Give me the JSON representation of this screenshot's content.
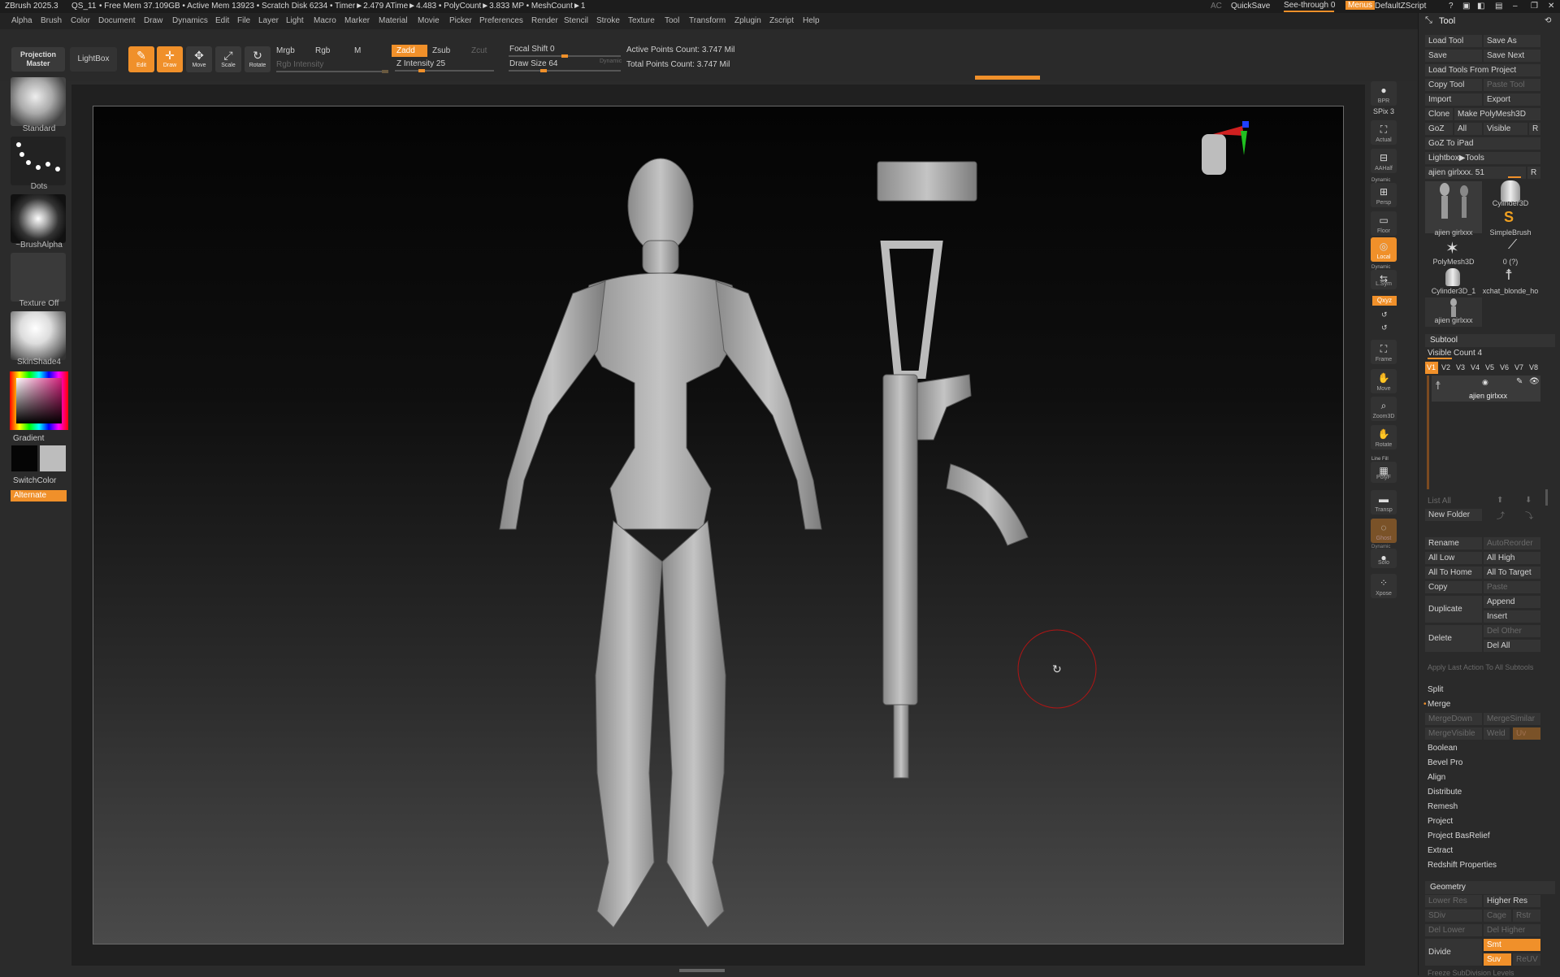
{
  "titlebar": {
    "app": "ZBrush 2025.3",
    "doc": "QS_11",
    "stats": "• Free Mem 37.109GB • Active Mem 13923 • Scratch Disk 6234 • Timer►2.479 ATime►4.483 • PolyCount►3.833 MP • MeshCount►1",
    "ac": "AC",
    "quicksave": "QuickSave",
    "seethrough": "See-through 0",
    "menus": "Menus",
    "script": "DefaultZScript"
  },
  "menu": [
    "Alpha",
    "Brush",
    "Color",
    "Document",
    "Draw",
    "Dynamics",
    "Edit",
    "File",
    "Layer",
    "Light",
    "Macro",
    "Marker",
    "Material",
    "Movie",
    "Picker",
    "Preferences",
    "Render",
    "Stencil",
    "Stroke",
    "Texture",
    "Tool",
    "Transform",
    "Zplugin",
    "Zscript",
    "Help"
  ],
  "toolbar": {
    "projection_master": "Projection Master",
    "lightbox": "LightBox",
    "edit": "Edit",
    "draw": "Draw",
    "move": "Move",
    "scale": "Scale",
    "rotate": "Rotate",
    "mrgb": "Mrgb",
    "rgb": "Rgb",
    "m": "M",
    "rgb_intensity": "Rgb Intensity",
    "zadd": "Zadd",
    "zsub": "Zsub",
    "zcut": "Zcut",
    "z_intensity": "Z Intensity 25",
    "focal_shift": "Focal Shift 0",
    "draw_size": "Draw Size 64",
    "dynamic": "Dynamic",
    "active_points": "Active Points Count: 3.747 Mil",
    "total_points": "Total Points Count: 3.747 Mil",
    "z_intensity_level": 0.25,
    "draw_size_level": 0.3
  },
  "leftshelf": {
    "standard": "Standard",
    "dots": "Dots",
    "brushalpha": "~BrushAlpha",
    "texture_off": "Texture Off",
    "skinshade": "SkinShade4",
    "gradient": "Gradient",
    "switchcolor": "SwitchColor",
    "alternate": "Alternate"
  },
  "rightshelf": {
    "bpr": "BPR",
    "spix": "SPix 3",
    "actual": "Actual",
    "aahalf": "AAHalf",
    "dynamic1": "Dynamic",
    "persp": "Persp",
    "floor": "Floor",
    "local": "Local",
    "dynamic2": "Dynamic",
    "lsym": "L.Sym",
    "xyz": "Qxyz",
    "frame": "Frame",
    "move": "Move",
    "zoom3d": "Zoom3D",
    "rotate": "Rotate",
    "linefill": "Line Fill",
    "polyf": "PolyF",
    "transp": "Transp",
    "ghost": "Ghost",
    "dynamic3": "Dynamic",
    "solo": "Solo",
    "xpose": "Xpose"
  },
  "toolpanel": {
    "title": "Tool",
    "load_tool": "Load Tool",
    "save_as": "Save As",
    "save": "Save",
    "save_next": "Save Next",
    "load_from_project": "Load Tools From Project",
    "copy_tool": "Copy Tool",
    "paste_tool": "Paste Tool",
    "import": "Import",
    "export": "Export",
    "clone": "Clone",
    "make_polymesh": "Make PolyMesh3D",
    "goz": "GoZ",
    "all": "All",
    "visible": "Visible",
    "r": "R",
    "goz_ipad": "GoZ To iPad",
    "lightbox_tools": "Lightbox▶Tools",
    "current_tool": "ajien girlxxx. 51",
    "tools": [
      "ajien girlxxx",
      "Cylinder3D",
      "SimpleBrush",
      "PolyMesh3D",
      "0 (?)",
      "Cylinder3D_1",
      "xchat_blonde_ho",
      "ajien girlxxx"
    ],
    "subtool": "Subtool",
    "visible_count": "Visible Count 4",
    "v_tabs": [
      "V1",
      "V2",
      "V3",
      "V4",
      "V5",
      "V6",
      "V7",
      "V8"
    ],
    "subtool_name": "ajien girlxxx",
    "list_all": "List All",
    "new_folder": "New Folder",
    "rename": "Rename",
    "auto_reorder": "AutoReorder",
    "all_low": "All Low",
    "all_high": "All High",
    "all_to_home": "All To Home",
    "all_to_target": "All To Target",
    "copy": "Copy",
    "paste": "Paste",
    "duplicate": "Duplicate",
    "append": "Append",
    "insert": "Insert",
    "delete": "Delete",
    "del_other": "Del Other",
    "del_all": "Del All",
    "apply_last": "Apply Last Action To All Subtools",
    "split": "Split",
    "merge": "Merge",
    "merge_down": "MergeDown",
    "merge_similar": "MergeSimilar",
    "merge_visible": "MergeVisible",
    "weld": "Weld",
    "uv": "Uv",
    "boolean": "Boolean",
    "bevel_pro": "Bevel Pro",
    "align": "Align",
    "distribute": "Distribute",
    "remesh": "Remesh",
    "project": "Project",
    "project_basrelief": "Project BasRelief",
    "extract": "Extract",
    "redshift": "Redshift Properties",
    "geometry": "Geometry",
    "lower_res": "Lower Res",
    "higher_res": "Higher Res",
    "sdiv": "SDiv",
    "cage": "Cage",
    "rstr": "Rstr",
    "del_lower": "Del Lower",
    "del_higher": "Del Higher",
    "divide": "Divide",
    "smt": "Smt",
    "suv": "Suv",
    "reuv": "ReUV",
    "freeze": "Freeze SubDivision Levels"
  },
  "colors": {
    "accent": "#f0902a",
    "panel": "#2a2a2a",
    "bg": "#2b2b2b"
  }
}
